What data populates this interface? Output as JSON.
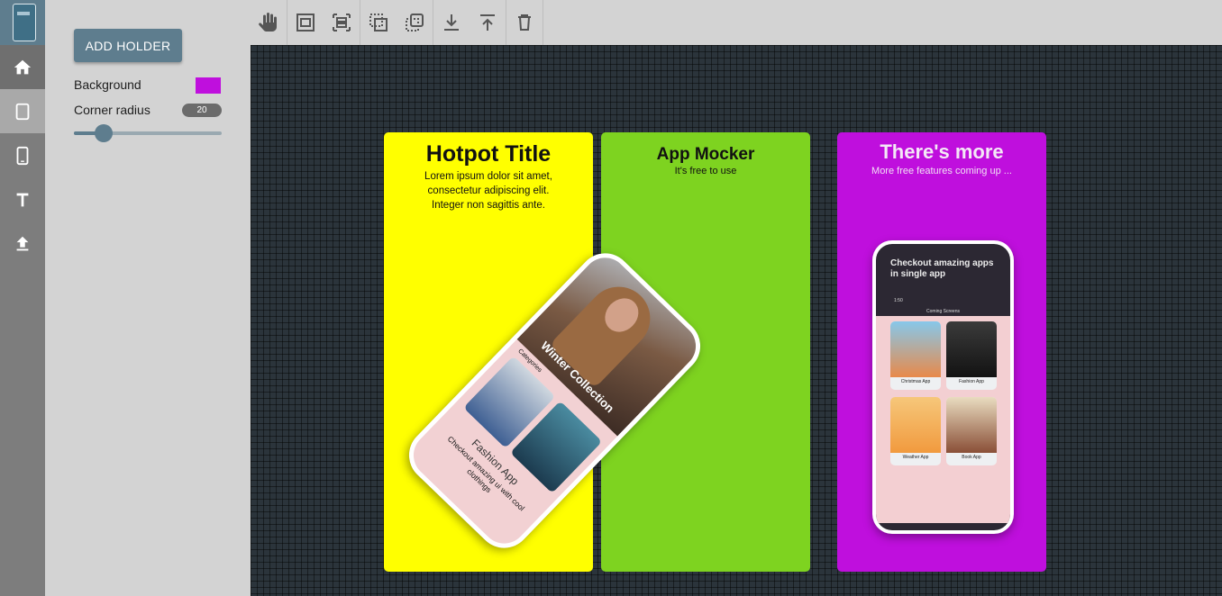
{
  "toolbar": {
    "tools": [
      {
        "name": "hand-tool",
        "icon": "hand-icon"
      },
      {
        "name": "fit-width-tool",
        "icon": "fit-width-icon"
      },
      {
        "name": "distribute-tool",
        "icon": "distribute-icon"
      },
      {
        "name": "send-backward-tool",
        "icon": "send-backward-icon"
      },
      {
        "name": "bring-forward-tool",
        "icon": "bring-forward-icon"
      },
      {
        "name": "download-tool",
        "icon": "download-icon"
      },
      {
        "name": "upload-tool",
        "icon": "upload-icon"
      },
      {
        "name": "delete-tool",
        "icon": "trash-icon"
      }
    ]
  },
  "rail": {
    "items": [
      {
        "icon": "home-icon"
      },
      {
        "icon": "tablet-icon"
      },
      {
        "icon": "phone-icon"
      },
      {
        "icon": "text-icon"
      },
      {
        "icon": "upload-icon"
      }
    ]
  },
  "panel": {
    "add_button": "ADD HOLDER",
    "background_label": "Background",
    "background_color": "#bf0fdd",
    "corner_radius_label": "Corner radius",
    "corner_radius_value": "20",
    "corner_radius_fraction": 0.2
  },
  "holders": [
    {
      "background": "#ffff00",
      "title": "Hotpot Title",
      "subtitle_lines": [
        "Lorem ipsum dolor sit amet,",
        "consectetur adipiscing elit.",
        "Integer non sagittis ante."
      ]
    },
    {
      "background": "#7ed320",
      "title": "App Mocker",
      "subtitle": "It's free to use"
    },
    {
      "background": "#bf0fdd",
      "title": "There's more",
      "subtitle": "More free features coming up ..."
    }
  ],
  "phone1": {
    "banner": "Winter Collection",
    "section": "Categories",
    "app_name": "Fashion App",
    "app_desc": "Checkout amazing ui with cool clothings"
  },
  "phone2": {
    "headline": "Checkout amazing apps in single app",
    "time": "1:50",
    "screen_title": "Coming Screens",
    "apps": [
      "Christmas App",
      "Fashion App",
      "Weather App",
      "Book App"
    ]
  },
  "colors": {
    "accent": "#5e7d8e",
    "canvas": "#2b343b",
    "yellow": "#ffff00",
    "green": "#7ed320",
    "purple": "#bf0fdd"
  }
}
